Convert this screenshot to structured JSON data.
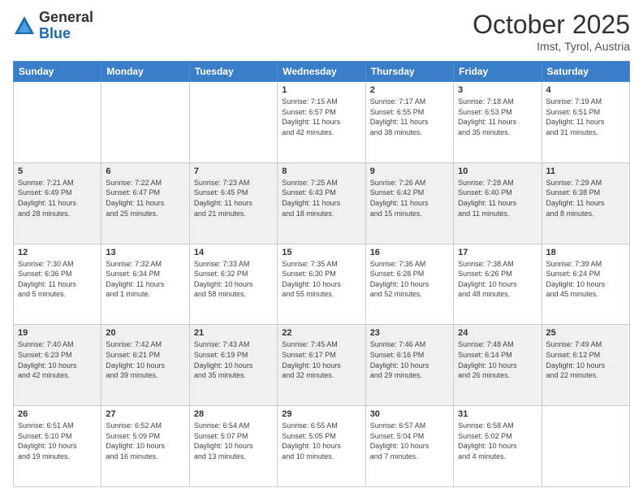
{
  "logo": {
    "general": "General",
    "blue": "Blue"
  },
  "title": {
    "month": "October 2025",
    "location": "Imst, Tyrol, Austria"
  },
  "days": [
    "Sunday",
    "Monday",
    "Tuesday",
    "Wednesday",
    "Thursday",
    "Friday",
    "Saturday"
  ],
  "weeks": [
    [
      {
        "date": "",
        "info": ""
      },
      {
        "date": "",
        "info": ""
      },
      {
        "date": "",
        "info": ""
      },
      {
        "date": "1",
        "info": "Sunrise: 7:15 AM\nSunset: 6:57 PM\nDaylight: 11 hours\nand 42 minutes."
      },
      {
        "date": "2",
        "info": "Sunrise: 7:17 AM\nSunset: 6:55 PM\nDaylight: 11 hours\nand 38 minutes."
      },
      {
        "date": "3",
        "info": "Sunrise: 7:18 AM\nSunset: 6:53 PM\nDaylight: 11 hours\nand 35 minutes."
      },
      {
        "date": "4",
        "info": "Sunrise: 7:19 AM\nSunset: 6:51 PM\nDaylight: 11 hours\nand 31 minutes."
      }
    ],
    [
      {
        "date": "5",
        "info": "Sunrise: 7:21 AM\nSunset: 6:49 PM\nDaylight: 11 hours\nand 28 minutes."
      },
      {
        "date": "6",
        "info": "Sunrise: 7:22 AM\nSunset: 6:47 PM\nDaylight: 11 hours\nand 25 minutes."
      },
      {
        "date": "7",
        "info": "Sunrise: 7:23 AM\nSunset: 6:45 PM\nDaylight: 11 hours\nand 21 minutes."
      },
      {
        "date": "8",
        "info": "Sunrise: 7:25 AM\nSunset: 6:43 PM\nDaylight: 11 hours\nand 18 minutes."
      },
      {
        "date": "9",
        "info": "Sunrise: 7:26 AM\nSunset: 6:42 PM\nDaylight: 11 hours\nand 15 minutes."
      },
      {
        "date": "10",
        "info": "Sunrise: 7:28 AM\nSunset: 6:40 PM\nDaylight: 11 hours\nand 11 minutes."
      },
      {
        "date": "11",
        "info": "Sunrise: 7:29 AM\nSunset: 6:38 PM\nDaylight: 11 hours\nand 8 minutes."
      }
    ],
    [
      {
        "date": "12",
        "info": "Sunrise: 7:30 AM\nSunset: 6:36 PM\nDaylight: 11 hours\nand 5 minutes."
      },
      {
        "date": "13",
        "info": "Sunrise: 7:32 AM\nSunset: 6:34 PM\nDaylight: 11 hours\nand 1 minute."
      },
      {
        "date": "14",
        "info": "Sunrise: 7:33 AM\nSunset: 6:32 PM\nDaylight: 10 hours\nand 58 minutes."
      },
      {
        "date": "15",
        "info": "Sunrise: 7:35 AM\nSunset: 6:30 PM\nDaylight: 10 hours\nand 55 minutes."
      },
      {
        "date": "16",
        "info": "Sunrise: 7:36 AM\nSunset: 6:28 PM\nDaylight: 10 hours\nand 52 minutes."
      },
      {
        "date": "17",
        "info": "Sunrise: 7:38 AM\nSunset: 6:26 PM\nDaylight: 10 hours\nand 48 minutes."
      },
      {
        "date": "18",
        "info": "Sunrise: 7:39 AM\nSunset: 6:24 PM\nDaylight: 10 hours\nand 45 minutes."
      }
    ],
    [
      {
        "date": "19",
        "info": "Sunrise: 7:40 AM\nSunset: 6:23 PM\nDaylight: 10 hours\nand 42 minutes."
      },
      {
        "date": "20",
        "info": "Sunrise: 7:42 AM\nSunset: 6:21 PM\nDaylight: 10 hours\nand 39 minutes."
      },
      {
        "date": "21",
        "info": "Sunrise: 7:43 AM\nSunset: 6:19 PM\nDaylight: 10 hours\nand 35 minutes."
      },
      {
        "date": "22",
        "info": "Sunrise: 7:45 AM\nSunset: 6:17 PM\nDaylight: 10 hours\nand 32 minutes."
      },
      {
        "date": "23",
        "info": "Sunrise: 7:46 AM\nSunset: 6:16 PM\nDaylight: 10 hours\nand 29 minutes."
      },
      {
        "date": "24",
        "info": "Sunrise: 7:48 AM\nSunset: 6:14 PM\nDaylight: 10 hours\nand 26 minutes."
      },
      {
        "date": "25",
        "info": "Sunrise: 7:49 AM\nSunset: 6:12 PM\nDaylight: 10 hours\nand 22 minutes."
      }
    ],
    [
      {
        "date": "26",
        "info": "Sunrise: 6:51 AM\nSunset: 5:10 PM\nDaylight: 10 hours\nand 19 minutes."
      },
      {
        "date": "27",
        "info": "Sunrise: 6:52 AM\nSunset: 5:09 PM\nDaylight: 10 hours\nand 16 minutes."
      },
      {
        "date": "28",
        "info": "Sunrise: 6:54 AM\nSunset: 5:07 PM\nDaylight: 10 hours\nand 13 minutes."
      },
      {
        "date": "29",
        "info": "Sunrise: 6:55 AM\nSunset: 5:05 PM\nDaylight: 10 hours\nand 10 minutes."
      },
      {
        "date": "30",
        "info": "Sunrise: 6:57 AM\nSunset: 5:04 PM\nDaylight: 10 hours\nand 7 minutes."
      },
      {
        "date": "31",
        "info": "Sunrise: 6:58 AM\nSunset: 5:02 PM\nDaylight: 10 hours\nand 4 minutes."
      },
      {
        "date": "",
        "info": ""
      }
    ]
  ]
}
